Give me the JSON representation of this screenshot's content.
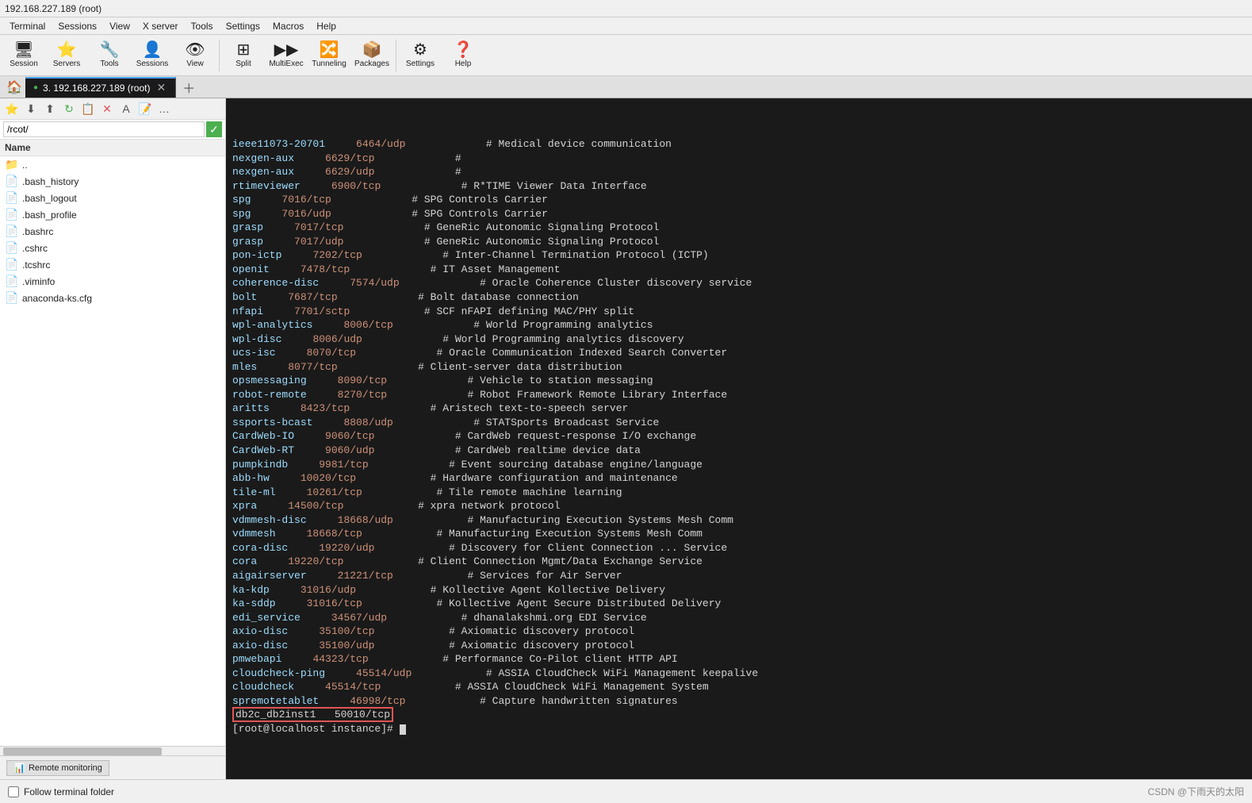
{
  "titlebar": {
    "title": "192.168.227.189 (root)"
  },
  "menubar": {
    "items": [
      "Terminal",
      "Sessions",
      "View",
      "X server",
      "Tools",
      "Settings",
      "Macros",
      "Help"
    ]
  },
  "toolbar": {
    "buttons": [
      {
        "label": "Session",
        "icon": "🖥"
      },
      {
        "label": "Servers",
        "icon": "🌐"
      },
      {
        "label": "Tools",
        "icon": "🔧"
      },
      {
        "label": "Sessions",
        "icon": "📋"
      },
      {
        "label": "View",
        "icon": "👁"
      },
      {
        "label": "Split",
        "icon": "⊞"
      },
      {
        "label": "MultiExec",
        "icon": "▶"
      },
      {
        "label": "Tunneling",
        "icon": "🔀"
      },
      {
        "label": "Packages",
        "icon": "📦"
      },
      {
        "label": "Settings",
        "icon": "⚙"
      },
      {
        "label": "Help",
        "icon": "❓"
      }
    ]
  },
  "tabs": {
    "active_tab": "3. 192.168.227.189 (root)"
  },
  "sidebar": {
    "path": "/rcot/",
    "header": "Name",
    "files": [
      {
        "name": "..",
        "icon": "📁"
      },
      {
        "name": ".bash_history",
        "icon": "📄"
      },
      {
        "name": ".bash_logout",
        "icon": "📄"
      },
      {
        "name": ".bash_profile",
        "icon": "📄"
      },
      {
        "name": ".bashrc",
        "icon": "📄"
      },
      {
        "name": ".cshrc",
        "icon": "📄"
      },
      {
        "name": ".tcshrc",
        "icon": "📄"
      },
      {
        "name": ".viminfo",
        "icon": "📄"
      },
      {
        "name": "anaconda-ks.cfg",
        "icon": "📄"
      }
    ]
  },
  "sidebar_bottom": {
    "remote_monitoring_label": "Remote monitoring"
  },
  "terminal": {
    "lines": [
      "ieee11073-20701 6464/udp             # Medical device communication",
      "nexgen-aux      6629/tcp             #",
      "nexgen-aux      6629/udp             #",
      "rtimeviewer     6900/tcp             # R*TIME Viewer Data Interface",
      "spg             7016/tcp             # SPG Controls Carrier",
      "spg             7016/udp             # SPG Controls Carrier",
      "grasp           7017/tcp             # GeneRic Autonomic Signaling Protocol",
      "grasp           7017/udp             # GeneRic Autonomic Signaling Protocol",
      "pon-ictp        7202/tcp             # Inter-Channel Termination Protocol (ICTP)",
      "openit          7478/tcp             # IT Asset Management",
      "coherence-disc  7574/udp             # Oracle Coherence Cluster discovery service",
      "bolt            7687/tcp             # Bolt database connection",
      "nfapi           7701/sctp            # SCF nFAPI defining MAC/PHY split",
      "wpl-analytics   8006/tcp             # World Programming analytics",
      "wpl-disc        8006/udp             # World Programming analytics discovery",
      "ucs-isc         8070/tcp             # Oracle Communication Indexed Search Converter",
      "mles            8077/tcp             # Client-server data distribution",
      "opsmessaging    8090/tcp             # Vehicle to station messaging",
      "robot-remote    8270/tcp             # Robot Framework Remote Library Interface",
      "aritts          8423/tcp             # Aristech text-to-speech server",
      "ssports-bcast   8808/udp             # STATSports Broadcast Service",
      "CardWeb-IO      9060/tcp             # CardWeb request-response I/O exchange",
      "CardWeb-RT      9060/udp             # CardWeb realtime device data",
      "pumpkindb        9981/tcp             # Event sourcing database engine/language",
      "abb-hw          10020/tcp            # Hardware configuration and maintenance",
      "tile-ml         10261/tcp            # Tile remote machine learning",
      "xpra            14500/tcp            # xpra network protocol",
      "vdmmesh-disc    18668/udp            # Manufacturing Execution Systems Mesh Comm",
      "vdmmesh         18668/tcp            # Manufacturing Execution Systems Mesh Comm",
      "cora-disc       19220/udp            # Discovery for Client Connection ... Service",
      "cora            19220/tcp            # Client Connection Mgmt/Data Exchange Service",
      "aigairserver    21221/tcp            # Services for Air Server",
      "ka-kdp          31016/udp            # Kollective Agent Kollective Delivery",
      "ka-sddp         31016/tcp            # Kollective Agent Secure Distributed Delivery",
      "edi_service     34567/udp            # dhanalakshmi.org EDI Service",
      "axio-disc       35100/tcp            # Axiomatic discovery protocol",
      "axio-disc       35100/udp            # Axiomatic discovery protocol",
      "pmwebapi        44323/tcp            # Performance Co-Pilot client HTTP API",
      "cloudcheck-ping 45514/udp            # ASSIA CloudCheck WiFi Management keepalive",
      "cloudcheck      45514/tcp            # ASSIA CloudCheck WiFi Management System",
      "spremotetablet  46998/tcp            # Capture handwritten signatures",
      "db2c_db2inst1   50010/tcp",
      "[root@localhost instance]# "
    ],
    "highlighted_line": "db2c_db2inst1   50010/tcp",
    "highlighted_line_index": 41
  },
  "statusbar": {
    "follow_terminal_folder_label": "Follow terminal folder",
    "follow_checked": false,
    "watermark": "CSDN @下雨天的太阳"
  }
}
